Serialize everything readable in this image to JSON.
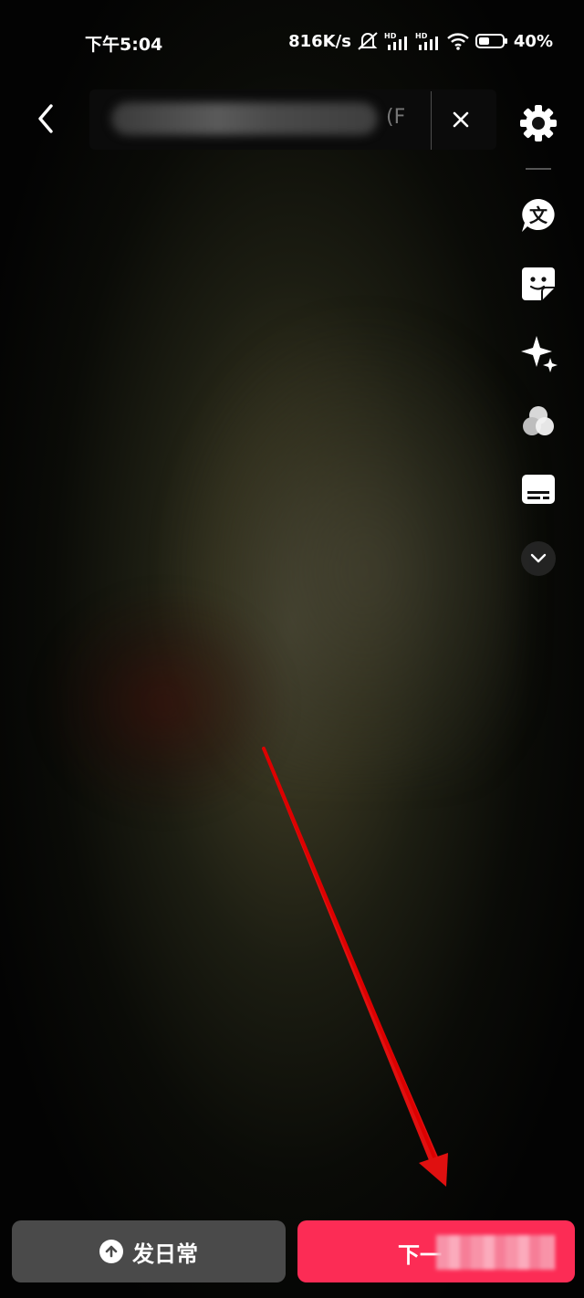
{
  "status_bar": {
    "time": "下午5:04",
    "network_speed": "816K/s",
    "battery": "40%",
    "icons": [
      "mute-icon",
      "signal-hd-icon",
      "signal-hd-icon",
      "wifi-icon",
      "battery-icon"
    ]
  },
  "top_bar": {
    "title_visible_suffix": "(F",
    "icons": [
      "back-icon",
      "close-icon",
      "settings-icon"
    ]
  },
  "tools": [
    {
      "name": "text-icon",
      "glyph": "文"
    },
    {
      "name": "sticker-icon"
    },
    {
      "name": "effects-icon"
    },
    {
      "name": "filter-icon"
    },
    {
      "name": "subtitle-icon"
    },
    {
      "name": "more-icon"
    }
  ],
  "bottom": {
    "daily_label": "发日常",
    "next_label": "下一"
  },
  "colors": {
    "next_button": "#fc2c55",
    "daily_button": "#4a4a4a",
    "annotation_arrow": "#e01010"
  }
}
